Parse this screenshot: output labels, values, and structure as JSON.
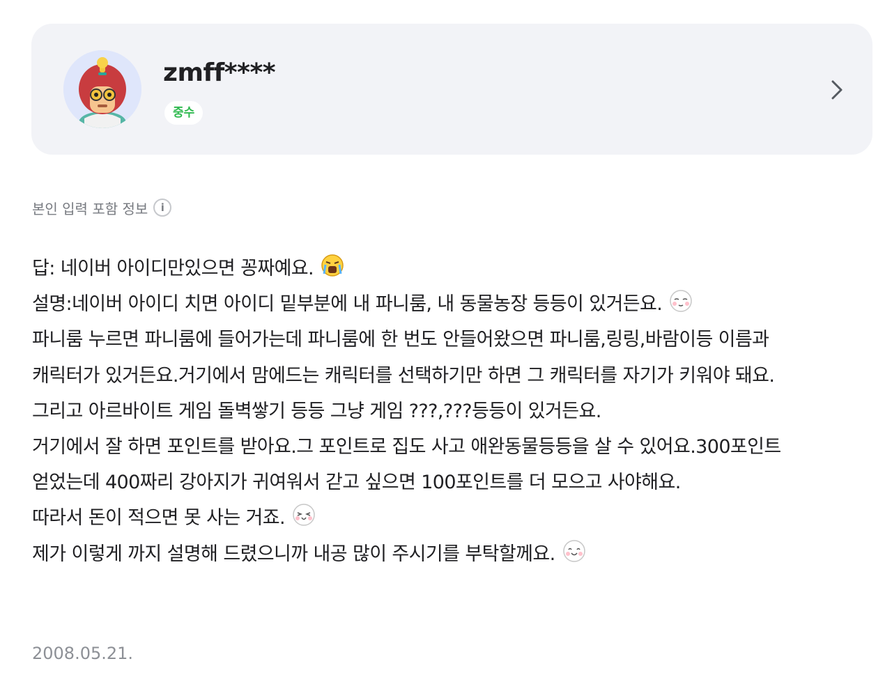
{
  "profile": {
    "username": "zmff****",
    "rank": "중수",
    "avatar_icon": "character-avatar-icon",
    "chevron_icon": "chevron-right-icon"
  },
  "info": {
    "label": "본인 입력 포함 정보",
    "icon": "info-icon",
    "icon_glyph": "i"
  },
  "answer_lines": [
    "답: 네이버 아이디만있으면 꽁짜예요.",
    "설명:네이버 아이디 치면 아이디 밑부분에 내 파니룸, 내 동물농장 등등이 있거든요.",
    "파니룸 누르면 파니룸에 들어가는데 파니룸에 한 번도 안들어왔으면 파니룸,링링,바람이등 이름과",
    "캐릭터가 있거든요.거기에서 맘에드는 캐릭터를 선택하기만 하면 그 캐릭터를 자기가 키워야 돼요.",
    "그리고 아르바이트 게임 돌벽쌓기 등등 그냥 게임 ???,???등등이 있거든요.",
    "거기에서 잘 하면 포인트를 받아요.그 포인트로 집도 사고 애완동물등등을 살 수 있어요.300포인트",
    "얻었는데 400짜리 강아지가 귀여워서 갇고 싶으면 100포인트를 더 모으고 사야해요.",
    "따라서 돈이 적으면 못 사는 거죠.",
    "제가 이렇게 까지 설명해 드렸으니까 내공 많이 주시기를 부탁할께요."
  ],
  "emoticons": [
    "crying-emoticon",
    "sleepy-emoticon",
    "happy-emoticon",
    "smile-emoticon"
  ],
  "date": "2008.05.21.",
  "colors": {
    "card_bg": "#f2f3f7",
    "badge_text": "#2fb94f",
    "muted_text": "#777a80"
  }
}
